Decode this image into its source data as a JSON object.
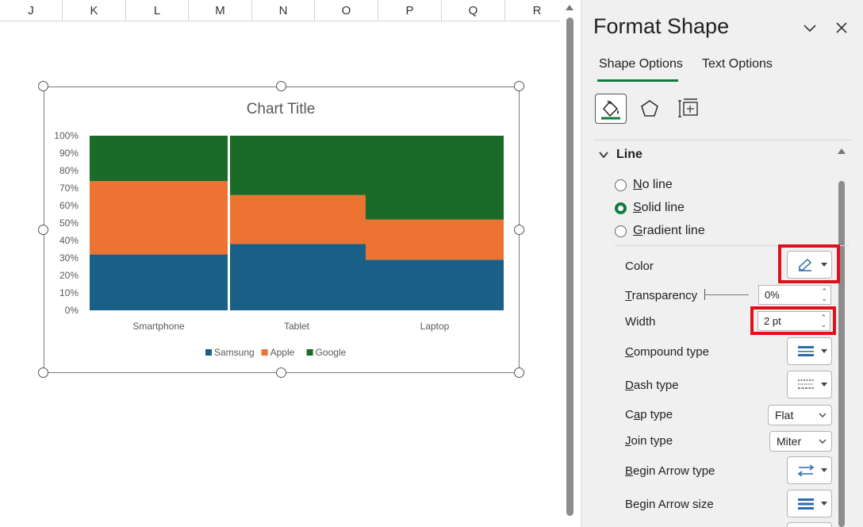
{
  "sheet": {
    "columns": [
      "J",
      "K",
      "L",
      "M",
      "N",
      "O",
      "P",
      "Q",
      "R"
    ]
  },
  "chart_data": {
    "type": "bar",
    "variant": "100% stacked column (variable width / mekko)",
    "title": "Chart Title",
    "categories": [
      "Smartphone",
      "Tablet",
      "Laptop"
    ],
    "series": [
      {
        "name": "Samsung",
        "values": [
          32,
          38,
          29
        ],
        "color": "#1a5f86"
      },
      {
        "name": "Apple",
        "values": [
          42,
          28,
          23
        ],
        "color": "#ec7332"
      },
      {
        "name": "Google",
        "values": [
          26,
          34,
          48
        ],
        "color": "#1b6b28"
      }
    ],
    "ylim": [
      0,
      100
    ],
    "yticks": [
      "0%",
      "10%",
      "20%",
      "30%",
      "40%",
      "50%",
      "60%",
      "70%",
      "80%",
      "90%",
      "100%"
    ],
    "xlabel": "",
    "ylabel": "",
    "legend": "bottom",
    "grid": false
  },
  "panel": {
    "title": "Format Shape",
    "tabs": [
      {
        "label": "Shape Options",
        "active": true
      },
      {
        "label": "Text Options",
        "active": false
      }
    ],
    "icons": [
      "fill-line-icon",
      "effects-pentagon-icon",
      "size-properties-icon"
    ],
    "section_title": "Line",
    "line_options": [
      {
        "label": "No line",
        "selected": false
      },
      {
        "label": "Solid line",
        "selected": true
      },
      {
        "label": "Gradient line",
        "selected": false
      }
    ],
    "props": {
      "color_label": "Color",
      "transparency_label": "Transparency",
      "transparency_value": "0%",
      "width_label": "Width",
      "width_value": "2 pt",
      "compound_label": "Compound type",
      "dash_label": "Dash type",
      "cap_label": "Cap type",
      "cap_value": "Flat",
      "join_label": "Join type",
      "join_value": "Miter",
      "begin_arrow_type_label": "Begin Arrow type",
      "begin_arrow_size_label": "Begin Arrow size"
    },
    "accent_color": "#107c41",
    "highlight_color": "#e0101a"
  }
}
